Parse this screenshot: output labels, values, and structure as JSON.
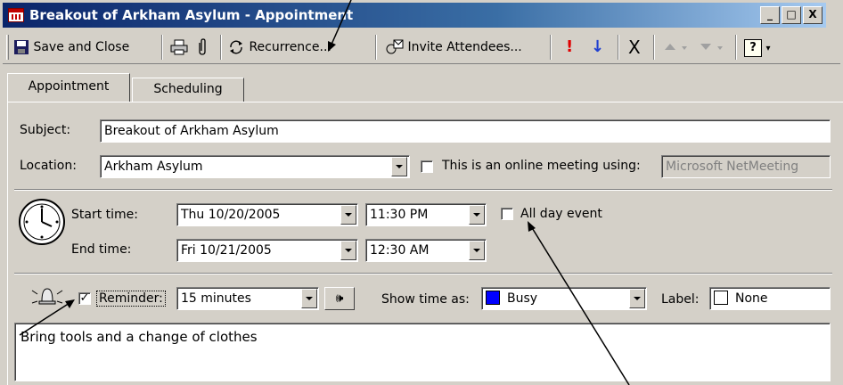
{
  "window": {
    "title": "Breakout of Arkham Asylum - Appointment",
    "minimize": "_",
    "maximize": "□",
    "close": "X"
  },
  "toolbar": {
    "save_close": "Save and Close",
    "recurrence": "Recurrence...",
    "invite": "Invite Attendees...",
    "importance_high": "!",
    "importance_low": "↓",
    "delete": "X",
    "help": "?"
  },
  "tabs": [
    {
      "label": "Appointment",
      "active": true
    },
    {
      "label": "Scheduling",
      "active": false
    }
  ],
  "form": {
    "subject_label": "Subject:",
    "subject_value": "Breakout of Arkham Asylum",
    "location_label": "Location:",
    "location_value": "Arkham Asylum",
    "online_label": "This is an online meeting using:",
    "online_value": "Microsoft NetMeeting",
    "start_label": "Start time:",
    "start_date": "Thu 10/20/2005",
    "start_time": "11:30 PM",
    "all_day_label": "All day event",
    "end_label": "End time:",
    "end_date": "Fri 10/21/2005",
    "end_time": "12:30 AM",
    "reminder_label": "Reminder:",
    "reminder_checked": true,
    "reminder_value": "15 minutes",
    "showtime_label": "Show time as:",
    "showtime_value": "Busy",
    "showtime_color": "#0000ff",
    "label_label": "Label:",
    "label_value": "None",
    "notes": "Bring tools and a change of clothes"
  }
}
